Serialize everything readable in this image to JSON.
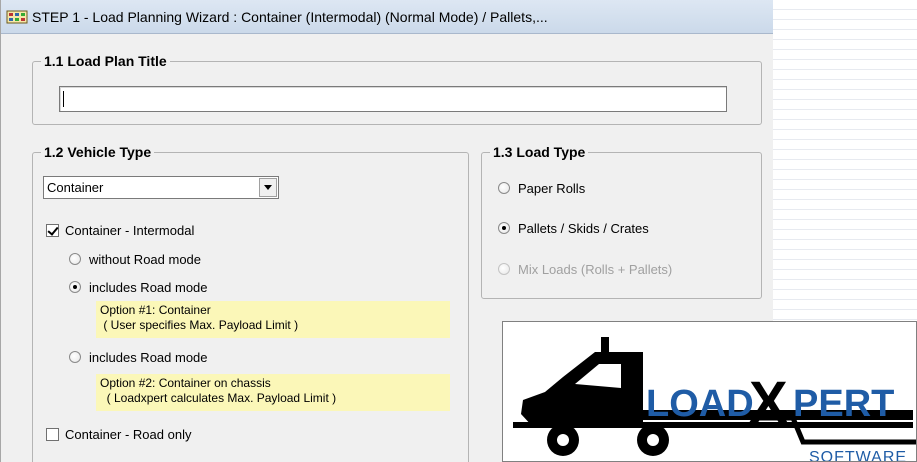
{
  "window": {
    "title": "STEP 1  -  Load Planning Wizard : Container (Intermodal) (Normal Mode) / Pallets,..."
  },
  "section_title": {
    "legend": "1.1 Load Plan Title",
    "input_value": ""
  },
  "section_vehicle": {
    "legend": "1.2 Vehicle Type",
    "combo_value": "Container",
    "intermodal_label": "Container - Intermodal",
    "intermodal_checked": true,
    "without_road_label": "without Road mode",
    "includes_road_label_1": "includes Road mode",
    "option1_line1": "Option #1: Container",
    "option1_line2": " ( User specifies Max. Payload Limit )",
    "includes_road_label_2": "includes Road mode",
    "option2_line1": "Option #2: Container on chassis",
    "option2_line2": "  ( Loadxpert calculates Max. Payload Limit )",
    "road_only_label": "Container - Road only",
    "road_only_checked": false
  },
  "section_load": {
    "legend": "1.3 Load Type",
    "paper_rolls_label": "Paper Rolls",
    "pallets_label": "Pallets / Skids / Crates",
    "mix_label": "Mix Loads (Rolls + Pallets)"
  },
  "logo": {
    "word_load": "LOAD",
    "word_x": "X",
    "word_pert": "PERT",
    "word_software": "SOFTWARE",
    "color_blue": "#1f5ca6",
    "color_black": "#000000"
  },
  "colors": {
    "note_background": "#fbf7b8",
    "window_background": "#f0f0f0"
  }
}
